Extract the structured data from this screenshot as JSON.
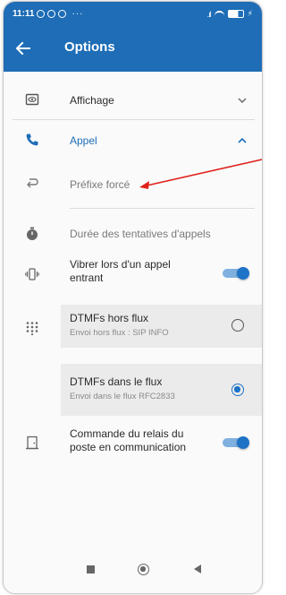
{
  "statusbar": {
    "time": "11:11",
    "more": "···",
    "signal": ".ıl"
  },
  "appbar": {
    "title": "Options"
  },
  "sections": {
    "affichage": {
      "label": "Affichage"
    },
    "appel": {
      "label": "Appel"
    }
  },
  "items": {
    "prefixe": {
      "label": "Préfixe forcé"
    },
    "duree": {
      "label": "Durée des tentatives d'appels"
    },
    "vibrer": {
      "label_line1": "Vibrer lors d'un appel",
      "label_line2": "entrant",
      "on": true
    },
    "dtmf_hors": {
      "label": "DTMFs hors flux",
      "sub": "Envoi hors flux : SIP INFO",
      "selected": false
    },
    "dtmf_dans": {
      "label": "DTMFs dans le flux",
      "sub": "Envoi dans le flux RFC2833",
      "selected": true
    },
    "relais": {
      "label_line1": "Commande du relais du",
      "label_line2": "poste en communication",
      "on": true
    }
  },
  "colors": {
    "primary": "#1e6db6",
    "accent": "#1e73c7",
    "annotation": "#e0201b"
  },
  "icons": {
    "back": "arrow-left-icon",
    "affichage": "eye-box-icon",
    "appel": "phone-icon",
    "prefixe": "forwarded-call-icon",
    "duree": "stopwatch-icon",
    "vibrer": "vibrate-icon",
    "dtmf": "dialpad-icon",
    "relais": "door-icon"
  }
}
